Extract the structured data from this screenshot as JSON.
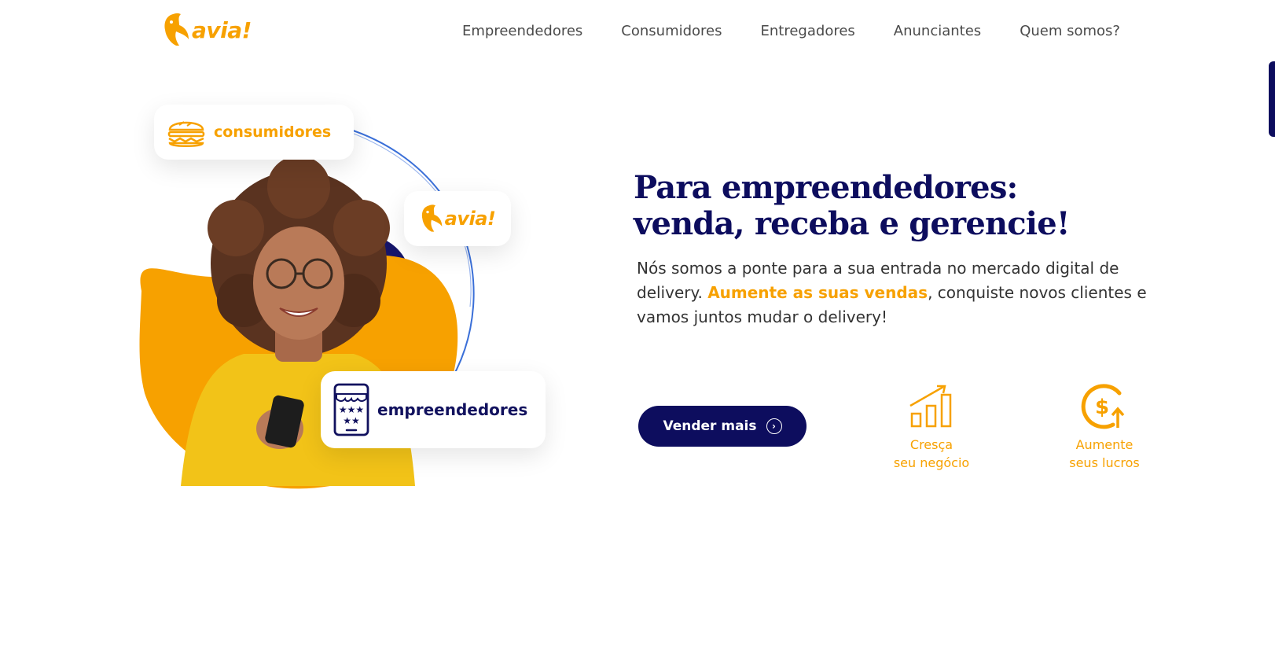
{
  "header": {
    "logo_text": "avia!",
    "nav": [
      "Empreendedores",
      "Consumidores",
      "Entregadores",
      "Anunciantes",
      "Quem somos?"
    ]
  },
  "hero_art": {
    "card_consumidores": "consumidores",
    "card_logo": "avia!",
    "card_empreendedores": "empreendedores"
  },
  "hero": {
    "headline_line1": "Para empreendedores:",
    "headline_line2": "venda, receba e gerencie!",
    "desc_part1": "Nós somos a ponte para a sua entrada no mercado digital de delivery. ",
    "desc_highlight": "Aumente as suas vendas",
    "desc_part2": ", conquiste novos clientes e vamos juntos mudar o delivery!",
    "cta_label": "Vender mais"
  },
  "features": [
    {
      "line1": "Cresça",
      "line2": "seu negócio",
      "icon": "growth-chart-icon"
    },
    {
      "line1": "Aumente",
      "line2": "seus lucros",
      "icon": "dollar-up-icon"
    }
  ],
  "colors": {
    "brand_orange": "#f7a100",
    "brand_navy": "#0d0d5e",
    "accent_yellow": "#f2c318",
    "ring_blue": "#3a6fd8"
  }
}
